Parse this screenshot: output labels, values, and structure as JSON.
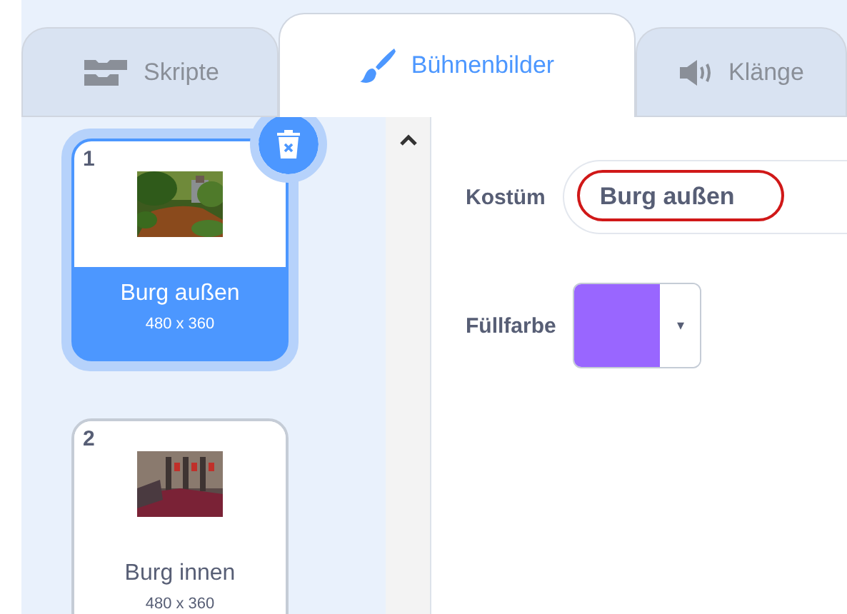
{
  "tabs": [
    {
      "label": "Skripte",
      "selected": false
    },
    {
      "label": "Bühnenbilder",
      "selected": true
    },
    {
      "label": "Klänge",
      "selected": false
    }
  ],
  "backdrops": [
    {
      "number": "1",
      "name": "Burg außen",
      "size": "480 x 360",
      "selected": true
    },
    {
      "number": "2",
      "name": "Burg innen",
      "size": "480 x 360",
      "selected": false
    }
  ],
  "editor": {
    "costume_label": "Kostüm",
    "costume_name": "Burg außen",
    "fill_label": "Füllfarbe",
    "dropdown": "▾"
  }
}
